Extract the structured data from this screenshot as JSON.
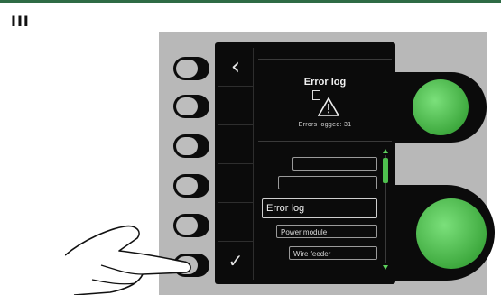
{
  "step_label": "III",
  "screen": {
    "back_icon": "chevron-left-icon",
    "confirm_icon": "checkmark-icon",
    "title": "Error log",
    "errors_logged": "Errors logged: 31",
    "menu": {
      "items": [
        {
          "label": ""
        },
        {
          "label": ""
        },
        {
          "label": "Error log",
          "selected": true
        },
        {
          "label": "Power module"
        },
        {
          "label": "Wire feeder"
        }
      ]
    }
  },
  "colors": {
    "accent_green": "#4ec04e",
    "panel_gray": "#b8b8b8",
    "top_line": "#2e6b45"
  }
}
